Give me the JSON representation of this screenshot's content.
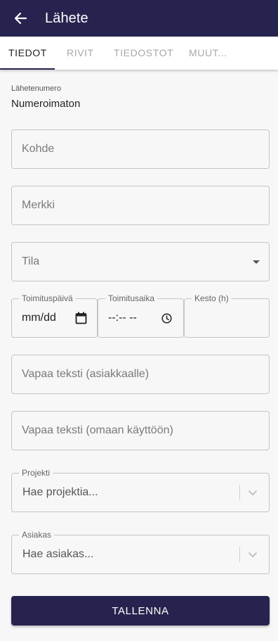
{
  "appbar": {
    "title": "Lähete",
    "back_icon": "arrow-back-icon"
  },
  "tabs": [
    {
      "label": "TIEDOT",
      "active": true
    },
    {
      "label": "RIVIT",
      "active": false
    },
    {
      "label": "TIEDOSTOT",
      "active": false
    },
    {
      "label": "MUUT...",
      "active": false
    }
  ],
  "form": {
    "number_caption": "Lähetenumero",
    "number_value": "Numeroimaton",
    "kohde_placeholder": "Kohde",
    "merkki_placeholder": "Merkki",
    "tila_placeholder": "Tila",
    "date_legend": "Toimituspäivä",
    "date_value": "mm/dd",
    "time_legend": "Toimitusaika",
    "time_value": "--:-- --",
    "kesto_legend": "Kesto (h)",
    "kesto_value": "",
    "free_text_customer_placeholder": "Vapaa teksti (asiakkaalle)",
    "free_text_own_placeholder": "Vapaa teksti (omaan käyttöön)",
    "project_legend": "Projekti",
    "project_placeholder": "Hae projektia...",
    "customer_legend": "Asiakas",
    "customer_placeholder": "Hae asiakas..."
  },
  "actions": {
    "save_label": "TALLENNA"
  },
  "colors": {
    "primary": "#27234f",
    "background": "#f7f7f8"
  }
}
